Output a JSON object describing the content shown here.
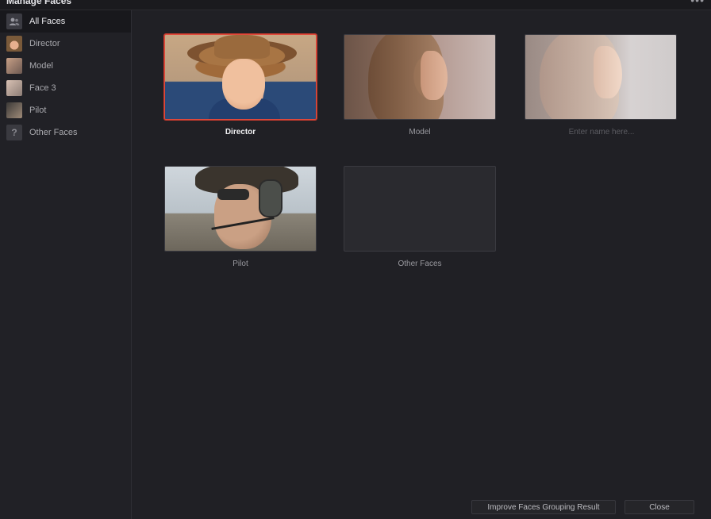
{
  "window": {
    "title": "Manage Faces",
    "menu_icon": "more-dots-icon"
  },
  "sidebar": {
    "items": [
      {
        "label": "All Faces",
        "icon": "people-icon",
        "active": true
      },
      {
        "label": "Director",
        "icon": "face-thumbnail"
      },
      {
        "label": "Model",
        "icon": "face-thumbnail"
      },
      {
        "label": "Face 3",
        "icon": "face-thumbnail"
      },
      {
        "label": "Pilot",
        "icon": "face-thumbnail"
      },
      {
        "label": "Other Faces",
        "icon": "unknown-face-icon",
        "glyph": "?"
      }
    ]
  },
  "grid": {
    "cards": [
      {
        "caption": "Director",
        "selected": true
      },
      {
        "caption": "Model"
      },
      {
        "caption": "",
        "placeholder": "Enter name here..."
      },
      {
        "caption": "Pilot"
      },
      {
        "caption": "Other Faces"
      }
    ]
  },
  "footer": {
    "improve_label": "Improve Faces Grouping Result",
    "close_label": "Close"
  },
  "colors": {
    "background": "#1f1f24",
    "selection": "#e0493b"
  }
}
